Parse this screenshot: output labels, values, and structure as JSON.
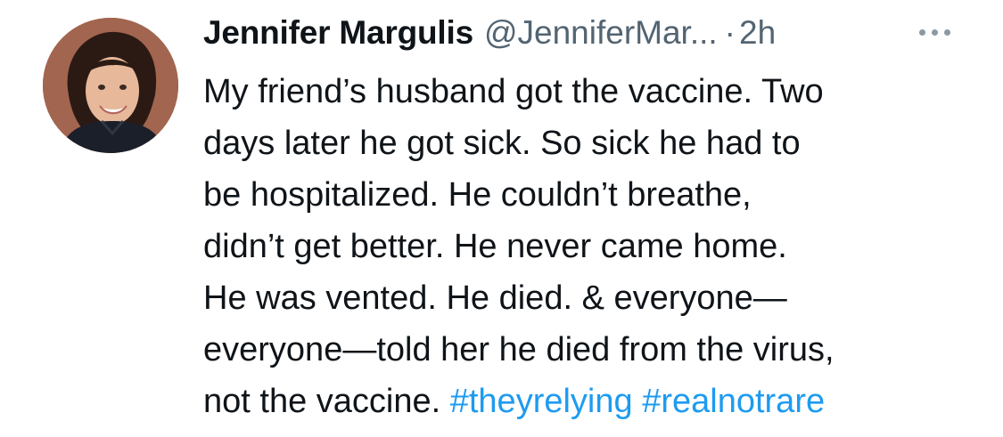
{
  "tweet": {
    "author_name": "Jennifer Margulis",
    "handle": "@JenniferMar...",
    "separator": "·",
    "time": "2h",
    "avatar": "avatar-photo",
    "more_icon": "more-options-icon",
    "lines": [
      "My friend’s husband got the vaccine. Two",
      "days later he got sick. So sick he had to",
      "be hospitalized. He couldn’t breathe,",
      "didn’t get better. He never came home.",
      "He was vented. He died. & everyone—",
      "everyone—told her he died from the virus,"
    ],
    "last_line_text": "not the vaccine. ",
    "hashtags": [
      "#theyrelying",
      "#realnotrare"
    ],
    "colors": {
      "text": "#0f1419",
      "secondary": "#536471",
      "link": "#1d9bf0",
      "background": "#ffffff"
    }
  }
}
